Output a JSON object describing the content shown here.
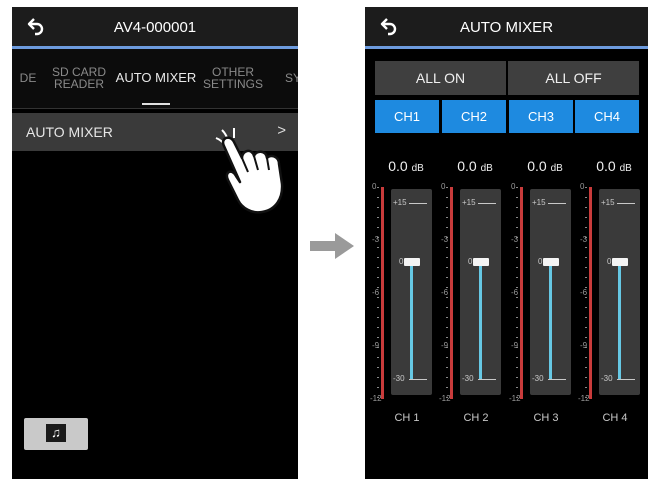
{
  "left_screen": {
    "title": "AV4-000001",
    "tabs": [
      {
        "label": "DE"
      },
      {
        "label": "SD CARD\nREADER"
      },
      {
        "label": "AUTO MIXER"
      },
      {
        "label": "OTHER\nSETTINGS"
      },
      {
        "label": "SY"
      }
    ],
    "active_tab": "AUTO MIXER",
    "menu_item": {
      "label": "AUTO MIXER",
      "chevron": ">"
    },
    "music_button_icon": "music-note-icon",
    "music_button_glyph": "♫"
  },
  "right_screen": {
    "title": "AUTO MIXER",
    "all_on_label": "ALL ON",
    "all_off_label": "ALL OFF",
    "channel_buttons": [
      "CH1",
      "CH2",
      "CH3",
      "CH4"
    ],
    "accent_color": "#1e8ae0",
    "meter_scale": [
      "0",
      "-3",
      "-6",
      "-9",
      "-12"
    ],
    "fader_scale": [
      "+15",
      "0",
      "-30"
    ],
    "channels": [
      {
        "db": "0.0",
        "unit": "dB",
        "label": "CH 1",
        "fader_db": 0
      },
      {
        "db": "0.0",
        "unit": "dB",
        "label": "CH 2",
        "fader_db": 0
      },
      {
        "db": "0.0",
        "unit": "dB",
        "label": "CH 3",
        "fader_db": 0
      },
      {
        "db": "0.0",
        "unit": "dB",
        "label": "CH 4",
        "fader_db": 0
      }
    ]
  }
}
